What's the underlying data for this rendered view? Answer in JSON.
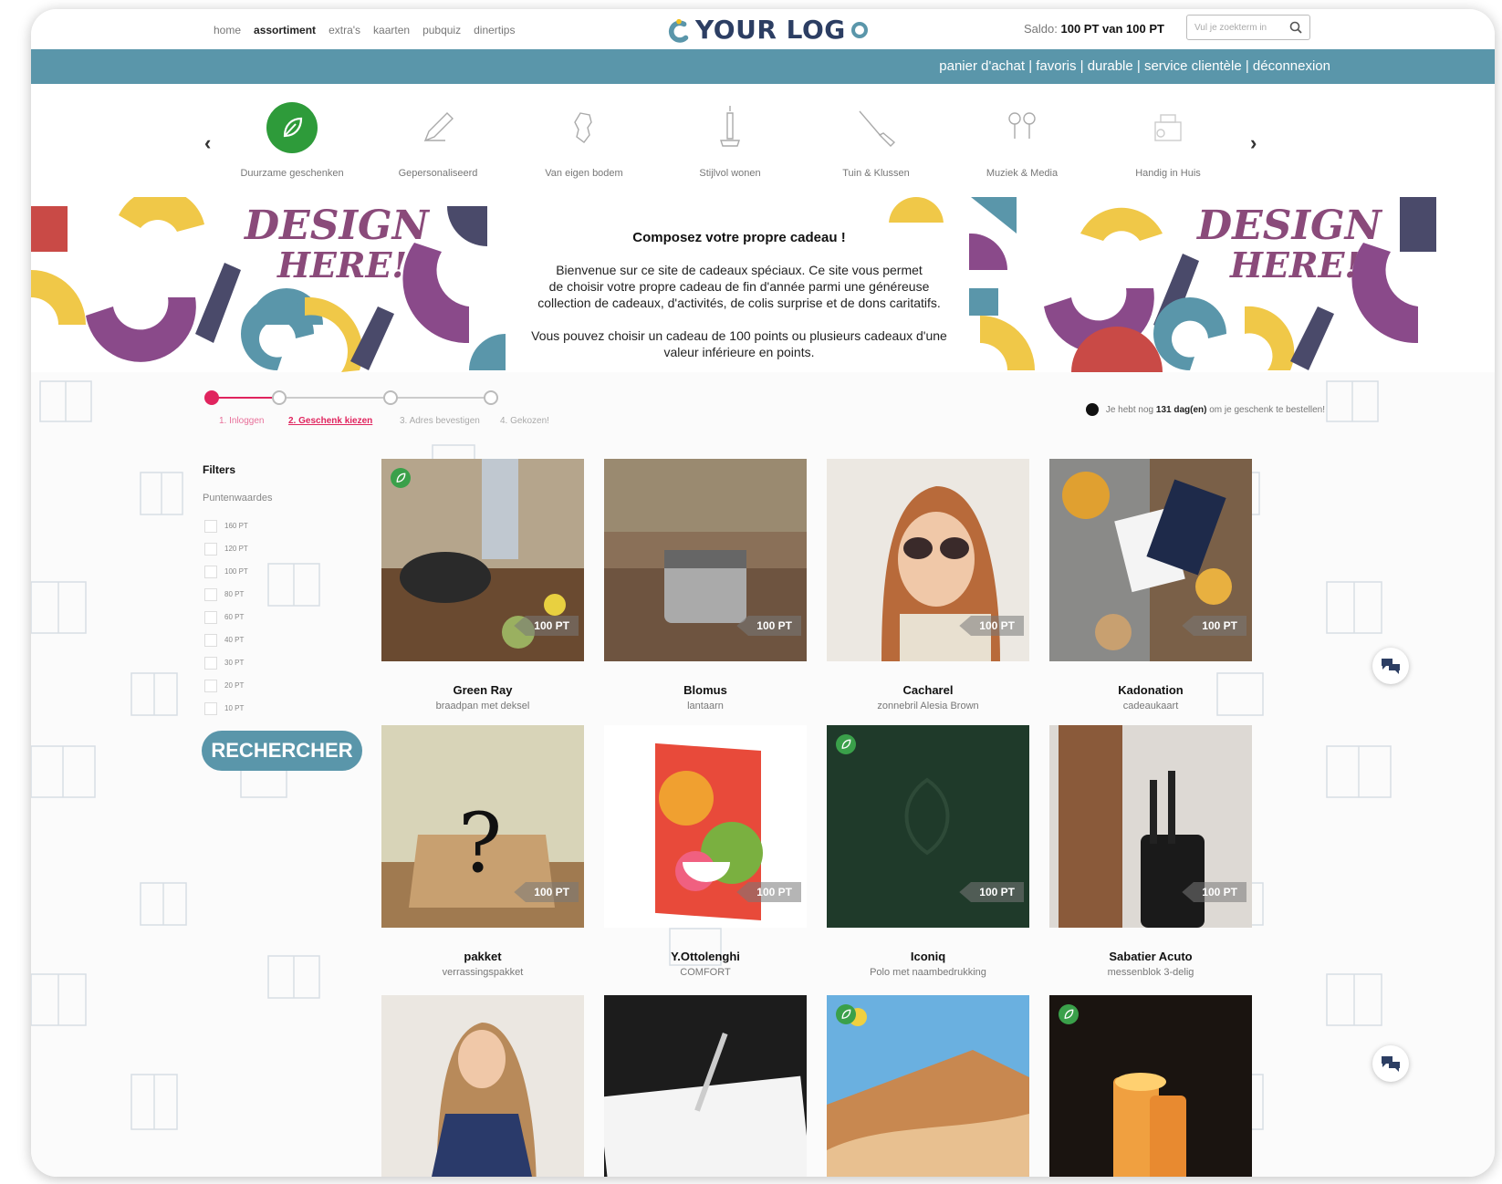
{
  "nav": {
    "items": [
      "home",
      "assortiment",
      "extra's",
      "kaarten",
      "pubquiz",
      "dinertips"
    ],
    "active": "assortiment"
  },
  "logo": {
    "text": "YOUR LOG"
  },
  "saldo": {
    "prefix": "Saldo: ",
    "value": "100 PT van 100 PT"
  },
  "search": {
    "placeholder": "Vul je zoekterm in"
  },
  "bluebar": {
    "links": [
      "panier d'achat",
      "favoris",
      "durable",
      "service clientèle",
      "déconnexion"
    ],
    "separator": " | "
  },
  "categories": [
    {
      "label": "Duurzame geschenken",
      "icon": "leaf-icon"
    },
    {
      "label": "Gepersonaliseerd",
      "icon": "pen-icon"
    },
    {
      "label": "Van eigen bodem",
      "icon": "map-icon"
    },
    {
      "label": "Stijlvol wonen",
      "icon": "candle-icon"
    },
    {
      "label": "Tuin & Klussen",
      "icon": "tools-icon"
    },
    {
      "label": "Muziek & Media",
      "icon": "earbuds-icon"
    },
    {
      "label": "Handig in Huis",
      "icon": "house-icon"
    }
  ],
  "banner": {
    "design_line1": "DESIGN",
    "design_line2": "HERE!",
    "title": "Composez votre propre cadeau !",
    "p1_line1": "Bienvenue sur ce site de cadeaux spéciaux. Ce site vous permet",
    "p1_line2": "de choisir votre propre cadeau de fin d'année parmi une généreuse",
    "p1_line3": "collection de cadeaux, d'activités, de colis surprise et de dons caritatifs.",
    "p2_line1": "Vous pouvez choisir un cadeau de 100 points ou plusieurs cadeaux d'une",
    "p2_line2": "valeur inférieure en points."
  },
  "steps": [
    "1. Inloggen",
    "2. Geschenk kiezen",
    "3. Adres bevestigen",
    "4. Gekozen!"
  ],
  "daysleft": {
    "before": "Je hebt nog ",
    "days": "131 dag(en)",
    "after": " om je geschenk te bestellen!"
  },
  "filters": {
    "title": "Filters",
    "subtitle": "Puntenwaardes",
    "options": [
      "160 PT",
      "120 PT",
      "100 PT",
      "80 PT",
      "60 PT",
      "40 PT",
      "30 PT",
      "20 PT",
      "10 PT"
    ]
  },
  "search_button": "RECHERCHER",
  "products": [
    {
      "name": "Green Ray",
      "desc": "braadpan met deksel",
      "points": "100 PT",
      "sustainable": true,
      "bg": "#6d6552"
    },
    {
      "name": "Blomus",
      "desc": "lantaarn",
      "points": "100 PT",
      "sustainable": false,
      "bg": "#7a6048"
    },
    {
      "name": "Cacharel",
      "desc": "zonnebril Alesia Brown",
      "points": "100 PT",
      "sustainable": false,
      "bg": "#e9e4de"
    },
    {
      "name": "Kadonation",
      "desc": "cadeaukaart",
      "points": "100 PT",
      "sustainable": false,
      "bg": "#8a6a4a"
    },
    {
      "name": "pakket",
      "desc": "verrassingspakket",
      "points": "100 PT",
      "sustainable": false,
      "bg": "#c9b597"
    },
    {
      "name": "Y.Ottolenghi",
      "desc": "COMFORT",
      "points": "100 PT",
      "sustainable": false,
      "bg": "#ffffff"
    },
    {
      "name": "Iconiq",
      "desc": "Polo met naambedrukking",
      "points": "100 PT",
      "sustainable": true,
      "bg": "#1f3a2a"
    },
    {
      "name": "Sabatier Acuto",
      "desc": "messenblok 3-delig",
      "points": "100 PT",
      "sustainable": false,
      "bg": "#d9d6d1"
    },
    {
      "name": "",
      "desc": "",
      "points": "",
      "sustainable": false,
      "bg": "#e8e3dc"
    },
    {
      "name": "",
      "desc": "",
      "points": "",
      "sustainable": false,
      "bg": "#1c1c1c"
    },
    {
      "name": "",
      "desc": "",
      "points": "",
      "sustainable": true,
      "bg": "#c89868"
    },
    {
      "name": "",
      "desc": "",
      "points": "",
      "sustainable": true,
      "bg": "#1a1410"
    }
  ],
  "colors": {
    "accent": "#5a96aa",
    "pink": "#e0245e",
    "green": "#2e9b3a",
    "navy": "#2c3e63"
  }
}
